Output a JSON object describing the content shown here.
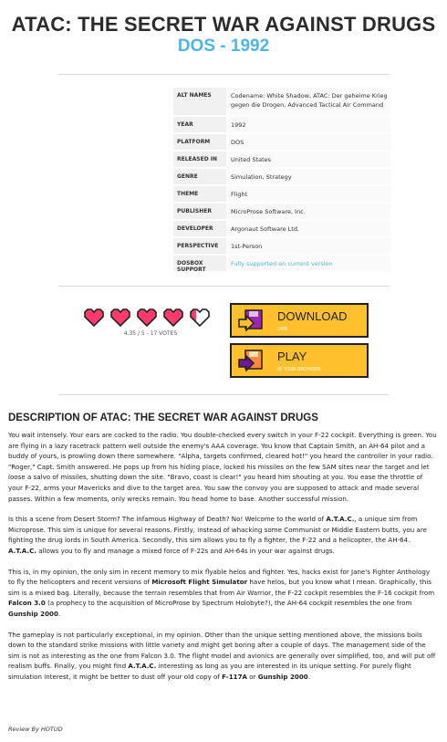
{
  "header": {
    "title": "ATAC: THE SECRET WAR AGAINST DRUGS",
    "subtitle": "DOS - 1992"
  },
  "info": [
    {
      "key": "ALT NAMES",
      "value": "Codename: White Shadow, ATAC: Der geheime Krieg gegen die Drogen, Advanced Tactical Air Command"
    },
    {
      "key": "YEAR",
      "value": "1992"
    },
    {
      "key": "PLATFORM",
      "value": "DOS"
    },
    {
      "key": "RELEASED IN",
      "value": "United States"
    },
    {
      "key": "GENRE",
      "value": "Simulation, Strategy"
    },
    {
      "key": "THEME",
      "value": "Flight"
    },
    {
      "key": "PUBLISHER",
      "value": "MicroProse Software, Inc."
    },
    {
      "key": "DEVELOPER",
      "value": "Argonaut Software Ltd."
    },
    {
      "key": "PERSPECTIVE",
      "value": "1st-Person"
    },
    {
      "key": "DOSBOX SUPPORT",
      "value": "Fully supported on current version"
    }
  ],
  "rating": {
    "score": 4.35,
    "max": 5,
    "votes_text": "4.35 / 5 - 17 VOTES",
    "full_color": "#ff3b6b",
    "empty_color": "#ffffff"
  },
  "download": {
    "label": "DOWNLOAD",
    "sub": "1MB",
    "icon": "download-disk-icon"
  },
  "play": {
    "label": "PLAY",
    "sub": "IN YOUR BROWSER",
    "icon": "play-disk-icon"
  },
  "description": {
    "title": "DESCRIPTION OF ATAC: THE SECRET WAR AGAINST DRUGS",
    "p1": "You wait intensely. Your ears are cocked to the radio. You double-checked every switch in your F-22 cockpit. Everything is green. You are flying in a lazy racetrack pattern well outside the enemy's AAA coverage. You know that Captain Smith, an AH-64 pilot and a buddy of yours, is prowling down there somewhere. \"Alpha, targets confirmed, cleared hot!\" you heard the controller in your radio. \"Roger,\" Capt. Smith answered. He pops up from his hiding place, locked his missiles on the few SAM sites near the target and let loose a salvo of missiles, shutting down the site. \"Bravo, coast is clear!\" you heard him shouting at you. You ease the throttle of your F-22, arms your Mavericks and dive to the target area. You saw the convoy you are supposed to attack and made several passes. Within a few moments, only wrecks remain. You head home to base. Another successful mission.",
    "p2a": "Is this a scene from Desert Storm? The infamous Highway of Death? No! Welcome to the world of ",
    "p2b": "A.T.A.C.",
    "p2c": ", a unique sim from Microprose. This sim is unique for several reasons. Firstly, instead of whacking some Communist or Middle Eastern butts, you are fighting the drug lords in South America. Secondly, this sim allows you to fly a fighter, the F-22 and a helicopter, the AH-64. ",
    "p2d": "A.T.A.C.",
    "p2e": " allows you to fly and manage a mixed force of F-22s and AH-64s in your war against drugs.",
    "p3a": "This is, in my opinion, the only sim in recent memory to mix flyable helos and fighter. Yes, hacks exist for Jane's Fighter Anthology to fly the helicopters and recent versions of ",
    "p3b": "Microsoft Flight Simulator",
    "p3c": " have helos, but you know what I mean. Graphically, this sim is a mixed bag. Literally, because the terrain resembles that from Air Warrior, the F-22 cockpit resembles the F-16 cockpit from ",
    "p3d": "Falcon 3.0",
    "p3e": " (a prophecy to the acquisition of MicroProse by Spectrum Holobyte?), the AH-64 cockpit resembles the one from ",
    "p3f": "Gunship 2000",
    "p3g": ".",
    "p4a": "The gameplay is not particularly exceptional, in my opinion. Other than the unique setting mentioned above, the missions boils down to the standard strike missions with little variety and might get boring after a couple of days. The management side of the sim is not as interesting as the one from Falcon 3.0. The flight model and avionics are generally over simplified, too, and will put off realism buffs. Finally, you might find ",
    "p4b": "A.T.A.C.",
    "p4c": " interesting as long as you are interested in its unique setting. For purely flight simulation interest, it might be better to dust off your old copy of ",
    "p4d": "F-117A",
    "p4e": " or ",
    "p4f": "Gunship 2000",
    "p4g": ".",
    "review_by": "Review By HOTUD"
  }
}
